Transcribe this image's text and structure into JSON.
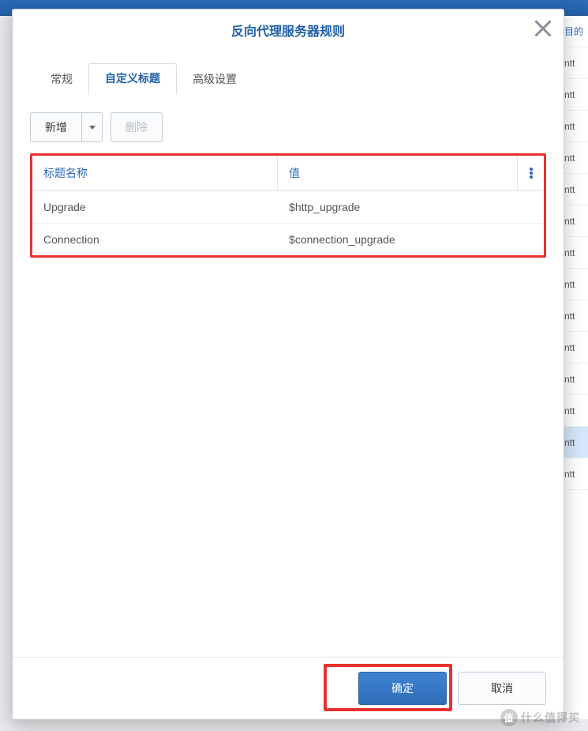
{
  "dialog": {
    "title": "反向代理服务器规则",
    "tabs": [
      {
        "label": "常规"
      },
      {
        "label": "自定义标题"
      },
      {
        "label": "高级设置"
      }
    ],
    "toolbar": {
      "add_label": "新增",
      "delete_label": "删除"
    },
    "table": {
      "headers": {
        "name": "标题名称",
        "value": "值"
      },
      "rows": [
        {
          "name": "Upgrade",
          "value": "$http_upgrade"
        },
        {
          "name": "Connection",
          "value": "$connection_upgrade"
        }
      ]
    },
    "footer": {
      "ok_label": "确定",
      "cancel_label": "取消"
    }
  },
  "background": {
    "header_col": "目的",
    "row_text": "ntt"
  },
  "watermark": "什么值得买"
}
